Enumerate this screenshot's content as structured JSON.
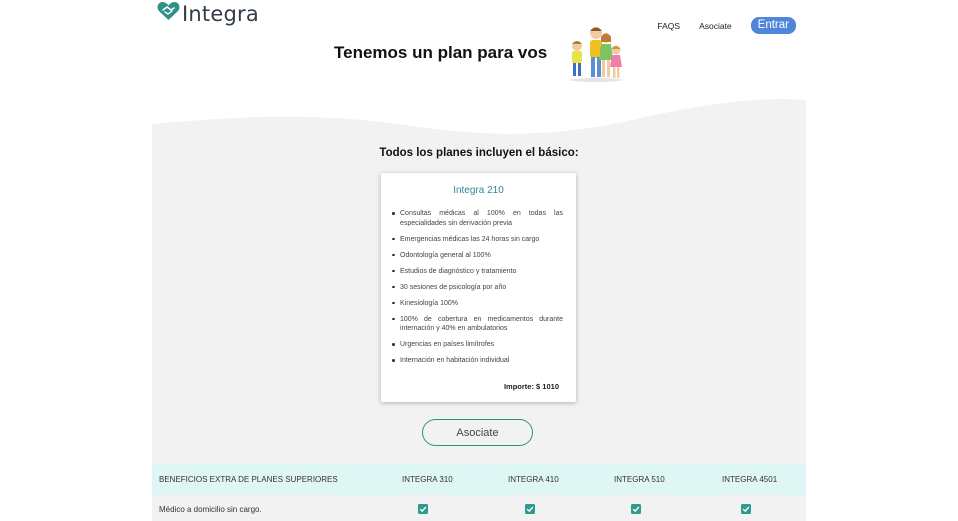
{
  "header": {
    "logo_text": "Integra",
    "nav": {
      "faqs": "FAQS",
      "asociate": "Asociate",
      "entrar": "Entrar"
    },
    "colors": {
      "accent": "#4f86d9",
      "teal": "#2c8a96"
    }
  },
  "hero": {
    "title": "Tenemos un plan para vos",
    "image": "family-illustration"
  },
  "plans": {
    "subtitle": "Todos los planes incluyen el básico:",
    "card": {
      "title": "Integra 210",
      "benefits": [
        "Consultas médicas al 100% en todas las especialidades sin derivación previa",
        "Emergencias médicas las 24 horas sin cargo",
        "Odontología general al 100%",
        "Estudios de diagnóstico y tratamiento",
        "30 sesiones de psicología por año",
        "Kinesiología 100%",
        "100% de cobertura en medicamentos durante internación y 40% en ambulatorios",
        "Urgencias en países limítrofes",
        "Internación en habitación individual"
      ],
      "price": "Importe: $ 1010"
    },
    "join_button": "Asociate"
  },
  "table": {
    "headers": [
      "BENEFICIOS EXTRA DE PLANES SUPERIORES",
      "INTEGRA 310",
      "INTEGRA 410",
      "INTEGRA 510",
      "INTEGRA 4501"
    ],
    "rows": [
      {
        "label": "Médico a domicilio sin cargo.",
        "checks": [
          true,
          true,
          true,
          true
        ]
      }
    ]
  }
}
